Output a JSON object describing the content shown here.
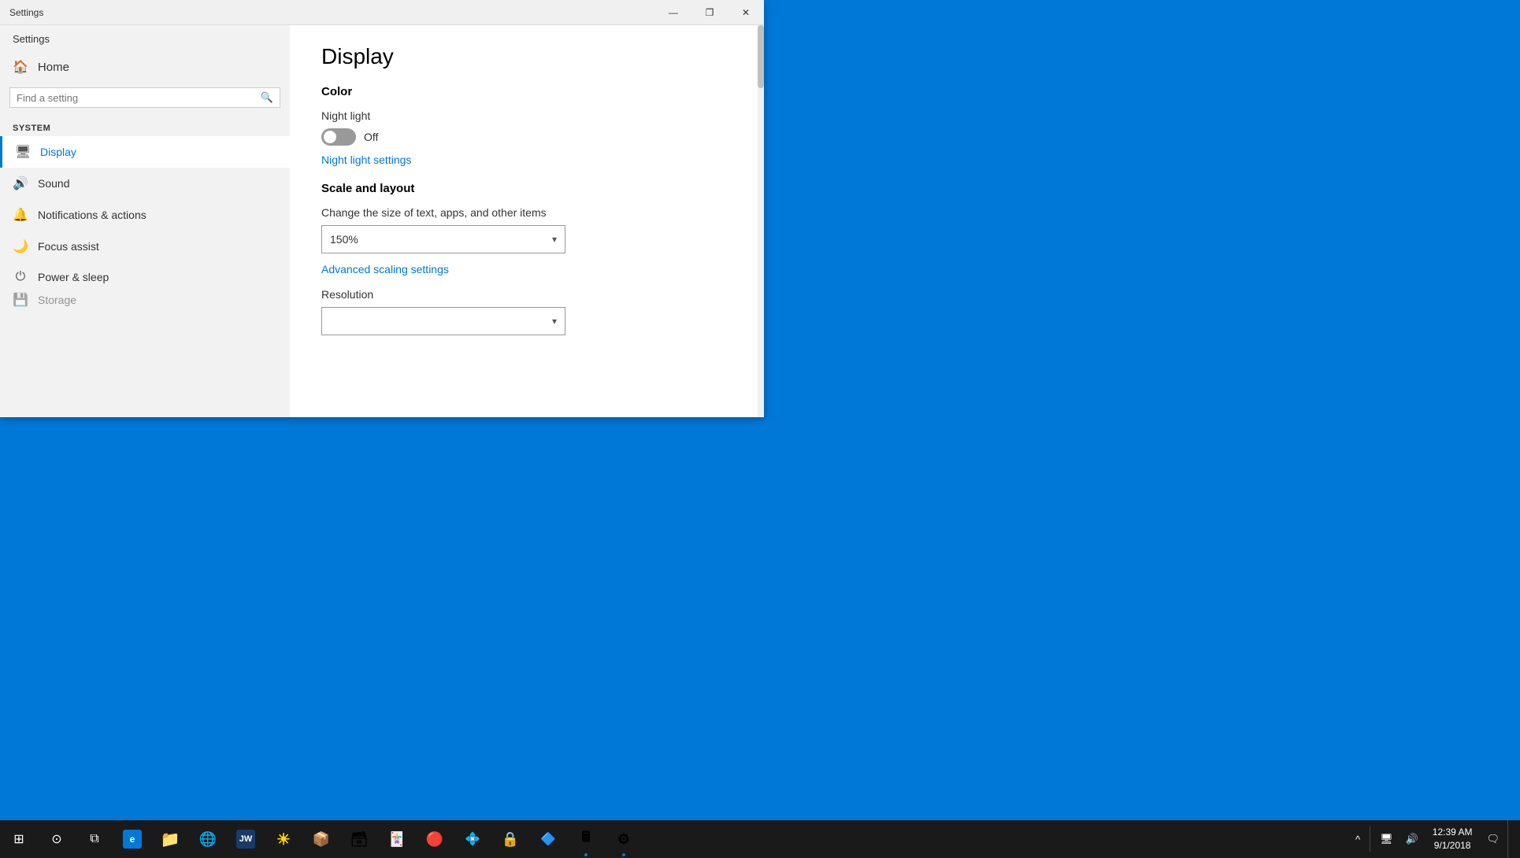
{
  "window": {
    "title": "Settings",
    "titleBarControls": {
      "minimize": "—",
      "maximize": "❐",
      "close": "✕"
    }
  },
  "sidebar": {
    "appTitle": "Settings",
    "homeLabel": "Home",
    "searchPlaceholder": "Find a setting",
    "sectionLabel": "System",
    "items": [
      {
        "id": "display",
        "label": "Display",
        "icon": "🖥",
        "active": true
      },
      {
        "id": "sound",
        "label": "Sound",
        "icon": "🔊",
        "active": false
      },
      {
        "id": "notifications",
        "label": "Notifications & actions",
        "icon": "🔔",
        "active": false
      },
      {
        "id": "focus",
        "label": "Focus assist",
        "icon": "🌙",
        "active": false
      },
      {
        "id": "power",
        "label": "Power & sleep",
        "icon": "⏻",
        "active": false
      },
      {
        "id": "storage",
        "label": "Storage",
        "icon": "💾",
        "active": false
      }
    ]
  },
  "main": {
    "pageTitle": "Display",
    "sections": {
      "color": {
        "heading": "Color",
        "nightLight": {
          "label": "Night light",
          "toggleState": "off",
          "toggleLabel": "Off"
        },
        "nightLightSettingsLink": "Night light settings"
      },
      "scaleLayout": {
        "heading": "Scale and layout",
        "sizeLabel": "Change the size of text, apps, and other items",
        "scaleValue": "150%",
        "advancedScalingLink": "Advanced scaling settings",
        "resolutionLabel": "Resolution"
      }
    }
  },
  "taskbar": {
    "startIcon": "⊞",
    "cortanaIcon": "⊙",
    "taskViewIcon": "❑",
    "apps": [
      {
        "id": "edge",
        "color": "#0078D7",
        "icon": "e",
        "running": false
      },
      {
        "id": "explorer",
        "color": "#FFB900",
        "icon": "📁",
        "running": false
      },
      {
        "id": "chrome",
        "color": "#4CAF50",
        "icon": "●",
        "running": false
      },
      {
        "id": "app1",
        "color": "#00B4D8",
        "icon": "W",
        "running": false
      },
      {
        "id": "app2",
        "color": "#FFB900",
        "icon": "☀",
        "running": false
      },
      {
        "id": "app3",
        "color": "#e63946",
        "icon": "Z",
        "running": false
      },
      {
        "id": "app4",
        "color": "#4CAF50",
        "icon": "S",
        "running": false
      },
      {
        "id": "app5",
        "color": "#e63946",
        "icon": "P",
        "running": false
      },
      {
        "id": "app6",
        "color": "#9B5DE5",
        "icon": "J",
        "running": false
      },
      {
        "id": "app7",
        "color": "#e63946",
        "icon": "🃏",
        "running": false
      },
      {
        "id": "app8",
        "color": "#00B4D8",
        "icon": "💎",
        "running": false
      },
      {
        "id": "app9",
        "color": "#e63946",
        "icon": "🔒",
        "running": false
      },
      {
        "id": "app10",
        "color": "#0078D7",
        "icon": "🔷",
        "running": false
      },
      {
        "id": "app11",
        "color": "#4CAF50",
        "icon": "🖩",
        "running": true
      },
      {
        "id": "settings-app",
        "color": "#555",
        "icon": "⚙",
        "running": true
      }
    ],
    "systemTray": {
      "notifIcon": "💬",
      "networkIcon": "🖥",
      "soundIcon": "🔊",
      "chrevronIcon": "^"
    },
    "clock": {
      "time": "12:39 AM",
      "date": "9/1/2018"
    },
    "notificationBadge": "🗨"
  }
}
